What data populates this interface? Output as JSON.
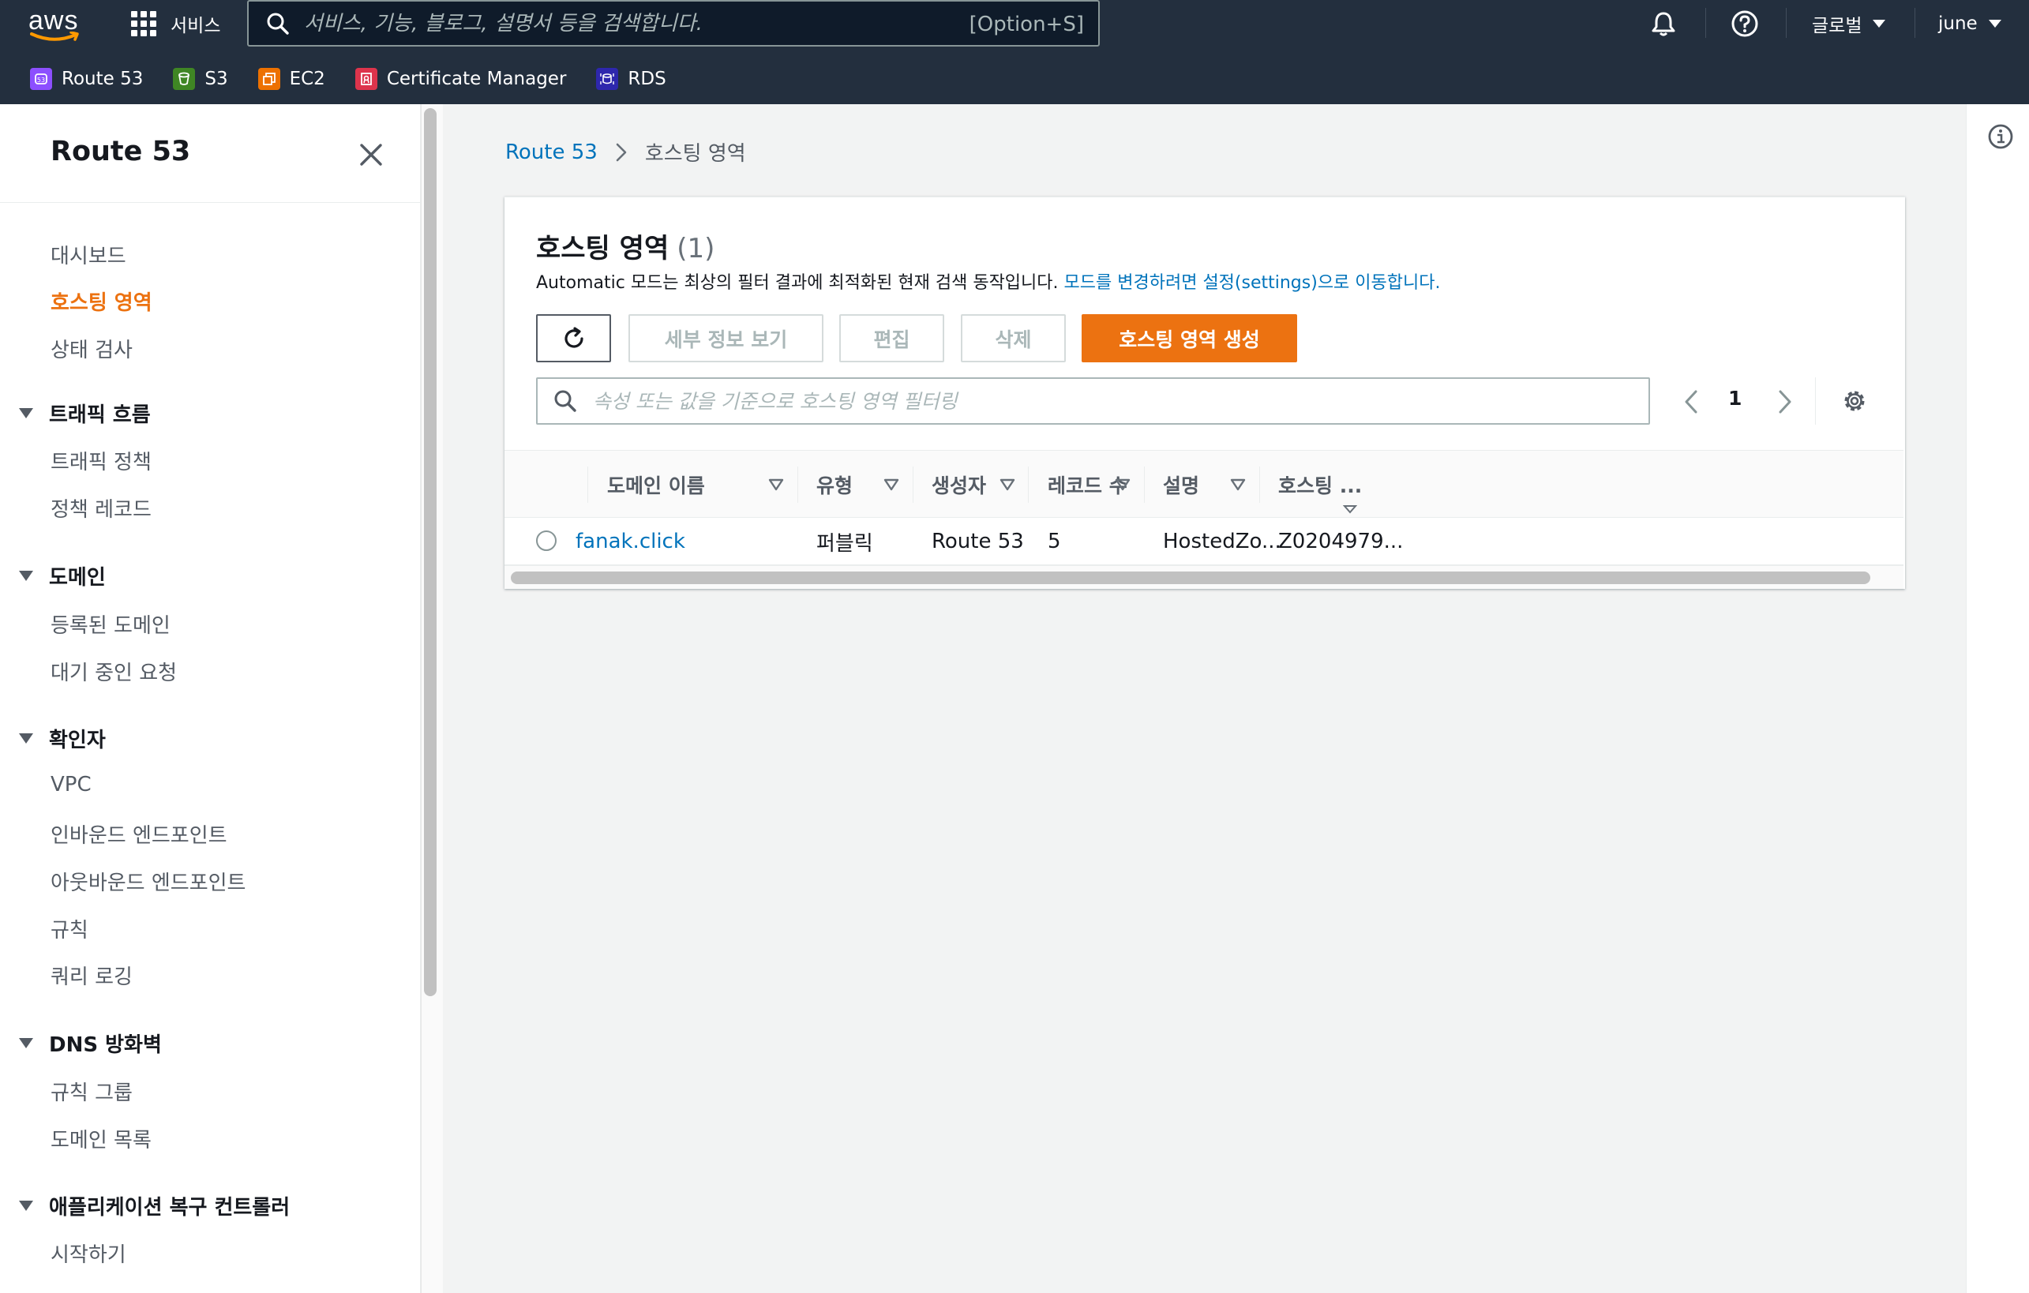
{
  "topnav": {
    "logo": "aws",
    "services_label": "서비스",
    "search_placeholder": "서비스, 기능, 블로그, 설명서 등을 검색합니다.",
    "search_shortcut": "[Option+S]",
    "region_label": "글로벌",
    "user_label": "june",
    "icons": [
      "grid-icon",
      "search-icon",
      "bell-icon",
      "help-icon",
      "caret-down-icon"
    ]
  },
  "favorites": [
    {
      "label": "Route 53",
      "color": "#8c4fff"
    },
    {
      "label": "S3",
      "color": "#3f8624"
    },
    {
      "label": "EC2",
      "color": "#ed7100"
    },
    {
      "label": "Certificate Manager",
      "color": "#dd344c"
    },
    {
      "label": "RDS",
      "color": "#2e27ad"
    }
  ],
  "sidebar": {
    "title": "Route 53",
    "items": [
      {
        "label": "대시보드"
      },
      {
        "label": "호스팅 영역",
        "active": true
      },
      {
        "label": "상태 검사"
      }
    ],
    "sections": [
      {
        "label": "트래픽 흐름",
        "items": [
          "트래픽 정책",
          "정책 레코드"
        ]
      },
      {
        "label": "도메인",
        "items": [
          "등록된 도메인",
          "대기 중인 요청"
        ]
      },
      {
        "label": "확인자",
        "items": [
          "VPC",
          "인바운드 엔드포인트",
          "아웃바운드 엔드포인트",
          "규칙",
          "쿼리 로깅"
        ]
      },
      {
        "label": "DNS 방화벽",
        "items": [
          "규칙 그룹",
          "도메인 목록"
        ]
      },
      {
        "label": "애플리케이션 복구 컨트롤러",
        "items": [
          "시작하기"
        ]
      }
    ]
  },
  "breadcrumb": {
    "root": "Route 53",
    "current": "호스팅 영역"
  },
  "panel": {
    "title": "호스팅 영역",
    "count": "(1)",
    "desc_text": "Automatic 모드는 최상의 필터 결과에 최적화된 현재 검색 동작입니다.",
    "desc_link": "모드를 변경하려면 설정(settings)으로 이동합니다.",
    "buttons": {
      "details": "세부 정보 보기",
      "edit": "편집",
      "delete": "삭제",
      "create": "호스팅 영역 생성"
    },
    "filter_placeholder": "속성 또는 값을 기준으로 호스팅 영역 필터링",
    "page": "1"
  },
  "table": {
    "columns": [
      "도메인 이름",
      "유형",
      "생성자",
      "레코드 수",
      "설명",
      "호스팅 ..."
    ],
    "rows": [
      {
        "domain": "fanak.click",
        "type": "퍼블릭",
        "creator": "Route 53",
        "records": "5",
        "description": "HostedZo...",
        "hosted_id": "Z0204979..."
      }
    ]
  },
  "colors": {
    "nav_bg": "#232f3e",
    "accent_orange": "#ec7211",
    "link_blue": "#0073bb"
  }
}
